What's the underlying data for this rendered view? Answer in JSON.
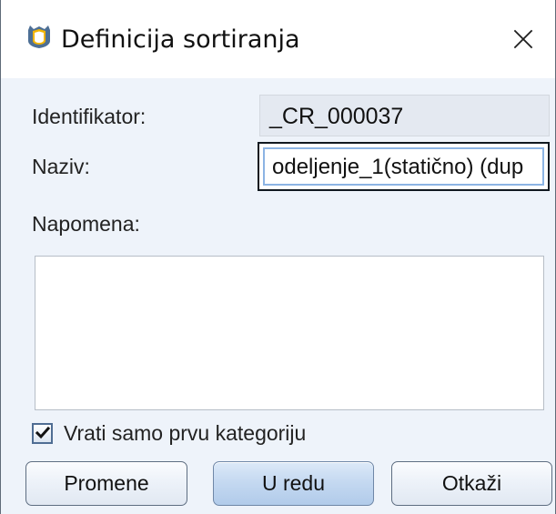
{
  "dialog": {
    "title": "Definicija sortiranja",
    "app_icon": "app-shield-icon",
    "close_icon": "close-icon"
  },
  "form": {
    "identifier_label": "Identifikator:",
    "identifier_value": "_CR_000037",
    "name_label": "Naziv:",
    "name_value": "odeljenje_1(statično) (dup",
    "note_label": "Napomena:",
    "note_value": "",
    "checkbox_label": "Vrati samo prvu kategoriju",
    "checkbox_checked": true
  },
  "buttons": {
    "changes": "Promene",
    "ok": "U redu",
    "cancel": "Otkaži"
  },
  "colors": {
    "window_background": "#eef3fa",
    "primary_button": "#c5d9f1",
    "focus_border": "#101820",
    "focus_inner_border": "#8cb4e4"
  }
}
